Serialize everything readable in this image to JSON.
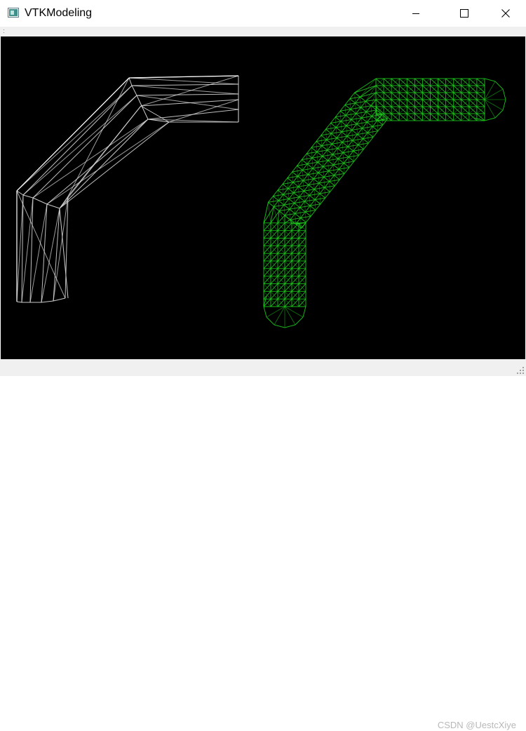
{
  "window": {
    "title": "VTKModeling",
    "icon": "vtk-app-icon",
    "controls": [
      "minimize-icon",
      "maximize-icon",
      "close-icon"
    ]
  },
  "viewport": {
    "background": "#000000",
    "left_model_color": "#e0e0e0",
    "right_model_color": "#19c419"
  },
  "watermark": {
    "text": "CSDN @UestcXiye"
  }
}
